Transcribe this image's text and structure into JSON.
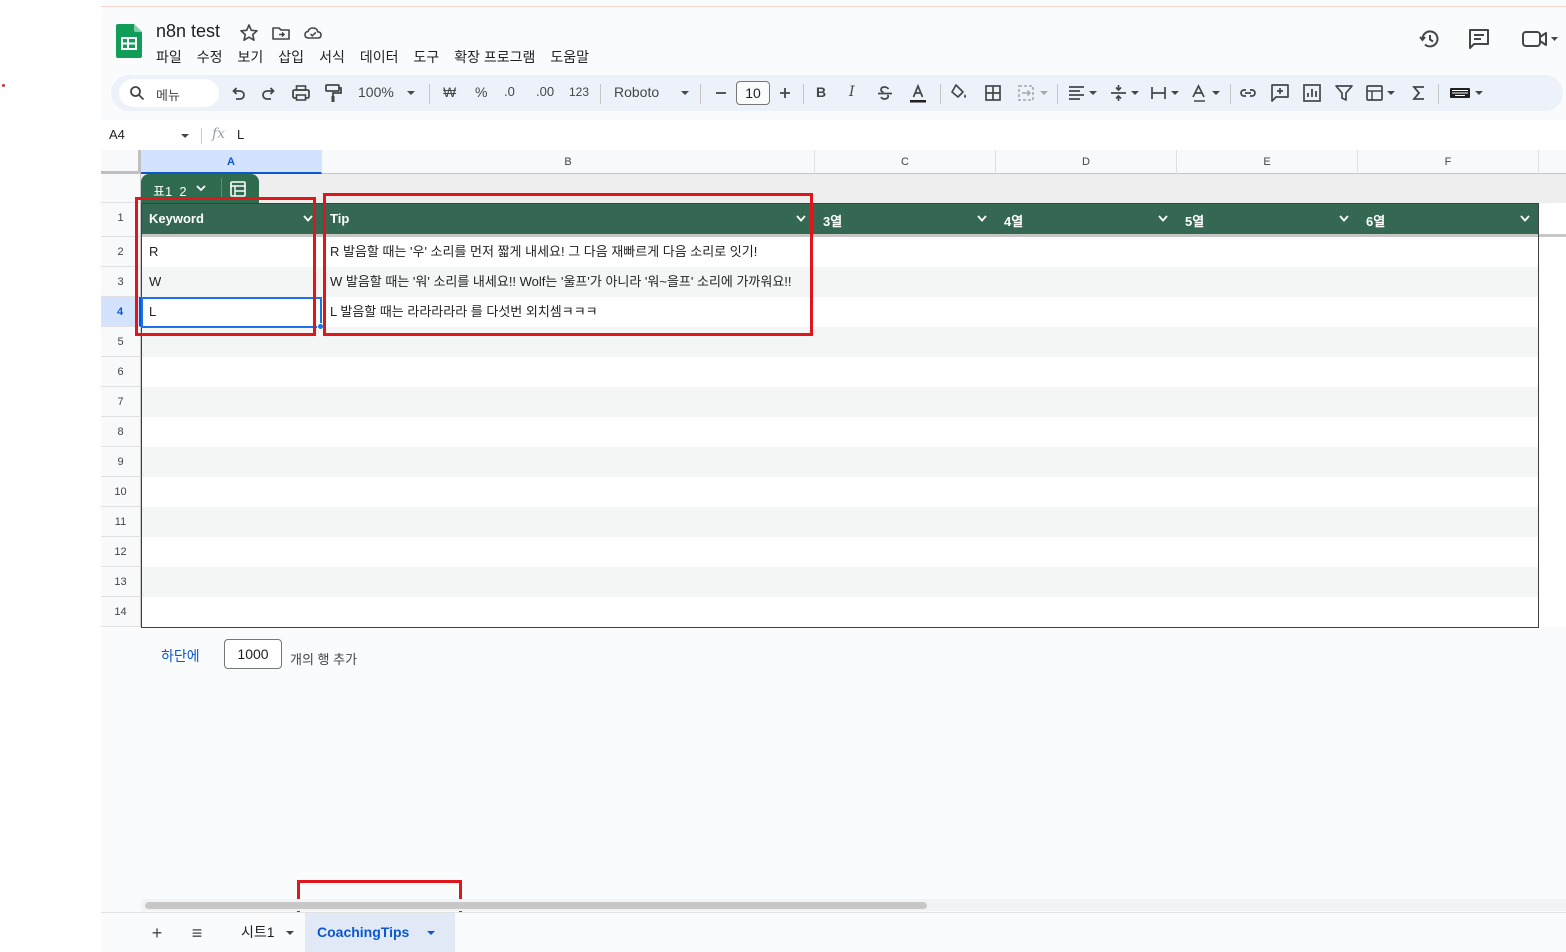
{
  "document": {
    "title": "n8n test",
    "menu": [
      "파일",
      "수정",
      "보기",
      "삽입",
      "서식",
      "데이터",
      "도구",
      "확장 프로그램",
      "도움말"
    ]
  },
  "toolbar": {
    "search_label": "메뉴",
    "zoom": "100%",
    "currency": "₩",
    "percent": "%",
    "decrease_decimal": ".0",
    "increase_decimal": ".00",
    "number_format": "123",
    "font": "Roboto",
    "font_size": "10",
    "bold": "B",
    "italic": "I"
  },
  "formula_bar": {
    "cell_ref": "A4",
    "fx": "fx",
    "value": "L"
  },
  "columns": [
    "A",
    "B",
    "C",
    "D",
    "E",
    "F"
  ],
  "rows": [
    "1",
    "2",
    "3",
    "4",
    "5",
    "6",
    "7",
    "8",
    "9",
    "10",
    "11",
    "12",
    "13",
    "14"
  ],
  "table": {
    "name": "표1_2",
    "headers": [
      "Keyword",
      "Tip",
      "3열",
      "4열",
      "5열",
      "6열"
    ],
    "data": [
      {
        "keyword": "R",
        "tip": "R 발음할 때는 '우' 소리를 먼저 짧게 내세요! 그 다음 재빠르게 다음 소리로 잇기!"
      },
      {
        "keyword": "W",
        "tip": "W 발음할 때는 '워' 소리를 내세요!! Wolf는 '울프'가 아니라 '워~을프' 소리에 가까워요!!"
      },
      {
        "keyword": "L",
        "tip": "L 발음할 때는 라라라라라 를 다섯번 외치셈ㅋㅋㅋ"
      }
    ]
  },
  "add_rows": {
    "link": "하단에",
    "count": "1000",
    "suffix": "개의 행 추가"
  },
  "sheets": {
    "add": "+",
    "list": "≡",
    "tabs": [
      {
        "label": "시트1",
        "active": false
      },
      {
        "label": "CoachingTips",
        "active": true
      }
    ]
  },
  "colors": {
    "table_header": "#356853",
    "selection": "#1a73e8",
    "annotation": "#e0161b",
    "sheets_green": "#0f9d58"
  }
}
